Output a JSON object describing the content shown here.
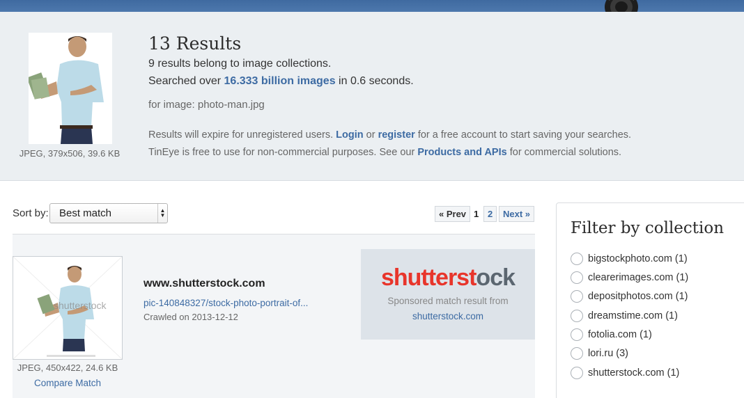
{
  "query": {
    "image_meta": "JPEG, 379x506, 39.6 KB",
    "results_count": "13 Results",
    "collections_line": "9 results belong to image collections.",
    "searched_prefix": "Searched over ",
    "searched_link": "16.333 billion images",
    "searched_suffix": " in 0.6 seconds.",
    "for_image": "for image: photo-man.jpg",
    "expire_prefix": "Results will expire for unregistered users. ",
    "login_link": "Login",
    "expire_or": " or ",
    "register_link": "register",
    "expire_suffix": " for a free account to start saving your searches.",
    "free_prefix": "TinEye is free to use for non-commercial purposes. See our ",
    "products_link": "Products and APIs",
    "free_suffix": " for commercial solutions."
  },
  "sort": {
    "label": "Sort by:",
    "selected": "Best match"
  },
  "pagination": {
    "prev": "« Prev",
    "current": "1",
    "page2": "2",
    "next": "Next »"
  },
  "results": [
    {
      "image_meta": "JPEG, 450x422, 24.6 KB",
      "compare_label": "Compare Match",
      "watermark": "shutterstock",
      "site": "www.shutterstock.com",
      "path": "pic-140848327/stock-photo-portrait-of...",
      "crawled": "Crawled on 2013-12-12"
    }
  ],
  "sponsored": {
    "logo_text_a": "shutterst",
    "logo_text_b": "o",
    "logo_text_c": "ck",
    "label": "Sponsored match result from",
    "link": "shutterstock.com",
    "brand_color": "#e8352b"
  },
  "filter": {
    "title": "Filter by collection",
    "items": [
      "bigstockphoto.com (1)",
      "clearerimages.com (1)",
      "depositphotos.com (1)",
      "dreamstime.com (1)",
      "fotolia.com (1)",
      "lori.ru (3)",
      "shutterstock.com (1)"
    ]
  },
  "colors": {
    "accent": "#3d6ba3",
    "topbar": "#4a73a8",
    "header_bg": "#ebeff2"
  }
}
